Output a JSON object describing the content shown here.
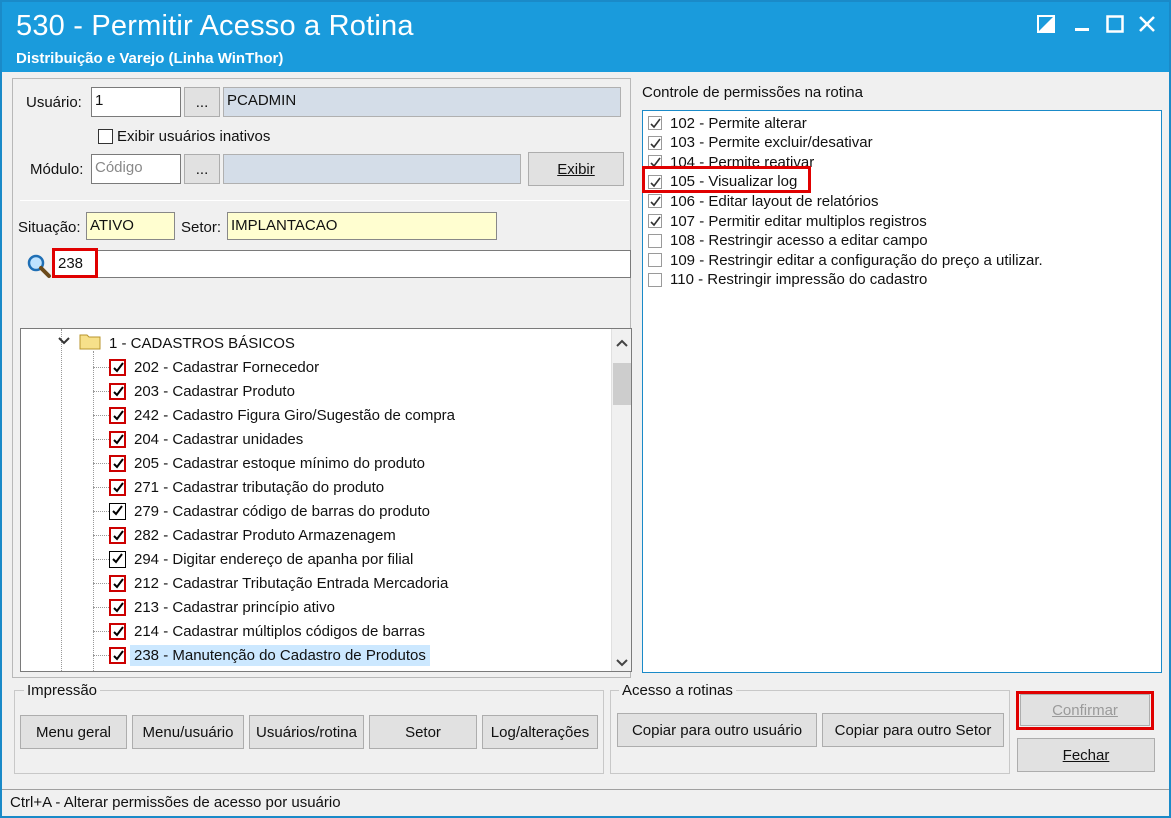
{
  "window": {
    "title": "530 - Permitir Acesso a Rotina",
    "subtitle": "Distribuição e Varejo (Linha WinThor)"
  },
  "form": {
    "usuario_label": "Usuário:",
    "usuario_code": "1",
    "usuario_lookup": "...",
    "usuario_name": "PCADMIN",
    "inativos_label": "Exibir usuários inativos",
    "modulo_label": "Módulo:",
    "modulo_placeholder": "Código",
    "modulo_lookup": "...",
    "exibir_label": "Exibir",
    "situacao_label": "Situação:",
    "situacao_value": "ATIVO",
    "setor_label": "Setor:",
    "setor_value": "IMPLANTACAO",
    "search_value": "238"
  },
  "tree": {
    "folder_label": "1 - CADASTROS BÁSICOS",
    "items": [
      {
        "label": "202 - Cadastrar  Fornecedor",
        "style": "red"
      },
      {
        "label": "203 - Cadastrar  Produto",
        "style": "red"
      },
      {
        "label": "242 - Cadastro Figura Giro/Sugestão de compra",
        "style": "red"
      },
      {
        "label": "204 - Cadastrar unidades",
        "style": "red"
      },
      {
        "label": "205 - Cadastrar estoque mínimo do produto",
        "style": "red"
      },
      {
        "label": "271 - Cadastrar tributação do produto",
        "style": "red"
      },
      {
        "label": "279 - Cadastrar código de barras do produto",
        "style": "black"
      },
      {
        "label": "282 - Cadastrar Produto Armazenagem",
        "style": "red"
      },
      {
        "label": "294 - Digitar endereço de apanha por filial",
        "style": "black"
      },
      {
        "label": "212 - Cadastrar Tributação Entrada Mercadoria",
        "style": "red"
      },
      {
        "label": "213 - Cadastrar princípio ativo",
        "style": "red"
      },
      {
        "label": "214 - Cadastrar múltiplos códigos de barras",
        "style": "red"
      },
      {
        "label": "238 - Manutenção do Cadastro de Produtos",
        "style": "red",
        "selected": true
      }
    ]
  },
  "permissions": {
    "title": "Controle de permissões na rotina",
    "items": [
      {
        "label": "102 - Permite alterar",
        "checked": true
      },
      {
        "label": "103 - Permite excluir/desativar",
        "checked": true
      },
      {
        "label": "104 - Permite reativar",
        "checked": true
      },
      {
        "label": "105 - Visualizar log",
        "checked": true
      },
      {
        "label": "106 - Editar layout de relatórios",
        "checked": true
      },
      {
        "label": "107 - Permitir editar multiplos registros",
        "checked": true
      },
      {
        "label": "108 - Restringir acesso a editar campo",
        "checked": false
      },
      {
        "label": "109 - Restringir editar a configuração do preço a utilizar.",
        "checked": false
      },
      {
        "label": "110 - Restringir impressão do cadastro",
        "checked": false
      }
    ]
  },
  "impressao": {
    "title": "Impressão",
    "buttons": [
      "Menu geral",
      "Menu/usuário",
      "Usuários/rotina",
      "Setor",
      "Log/alterações"
    ]
  },
  "acesso": {
    "title": "Acesso a rotinas",
    "buttons": [
      "Copiar para outro usuário",
      "Copiar para outro Setor"
    ]
  },
  "actions": {
    "confirmar": "Confirmar",
    "fechar": "Fechar"
  },
  "status": {
    "text": "Ctrl+A - Alterar permissões de acesso por usuário"
  },
  "colors": {
    "titlebar": "#1a9bdc",
    "highlight": "#e00000",
    "selection": "#cce8ff"
  }
}
